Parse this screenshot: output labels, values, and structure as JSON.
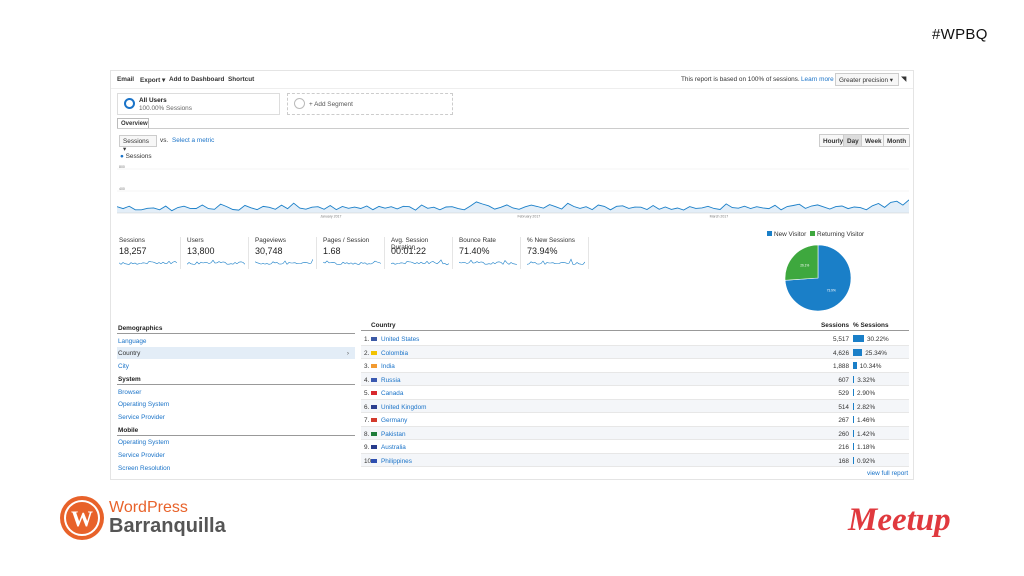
{
  "slide": {
    "hashtag": "#WPBQ"
  },
  "toolbar": {
    "items": [
      "Email",
      "Export ▾",
      "Add to Dashboard",
      "Shortcut"
    ],
    "report_note": "This report is based on 100% of sessions.",
    "learn_more": "Learn more",
    "precision": "Greater precision ▾"
  },
  "segments": {
    "all_users_title": "All Users",
    "all_users_sub": "100.00% Sessions",
    "add_segment": "+ Add Segment"
  },
  "tabs": {
    "overview": "Overview"
  },
  "chart_controls": {
    "metric": "Sessions ▾",
    "vs": "vs.",
    "select_metric": "Select a metric",
    "granularity": [
      "Hourly",
      "Day",
      "Week",
      "Month"
    ],
    "active_granularity": "Day",
    "legend": "Sessions"
  },
  "chart_data": {
    "type": "line",
    "series": [
      {
        "name": "Sessions",
        "values": [
          295,
          275,
          300,
          262,
          262,
          278,
          282,
          263,
          301,
          253,
          286,
          300,
          277,
          276,
          313,
          275,
          268,
          322,
          296,
          266,
          259,
          308,
          283,
          265,
          298,
          289,
          268,
          311,
          274,
          331,
          280,
          269,
          290,
          295,
          268,
          307,
          265,
          297,
          278,
          291,
          276,
          302,
          264,
          298,
          279,
          295,
          272,
          299,
          295,
          259,
          313,
          278,
          290,
          262,
          292,
          295,
          275,
          263,
          302,
          345,
          323,
          304,
          270,
          289,
          314,
          281,
          268,
          294,
          311,
          297,
          279,
          317,
          295,
          271,
          330,
          297,
          277,
          295,
          265,
          312,
          298,
          263,
          299,
          304,
          277,
          291,
          290,
          266,
          307,
          268,
          292,
          267,
          281,
          260,
          296,
          277,
          282,
          299,
          276,
          266,
          324,
          285,
          279,
          300,
          276,
          295,
          282,
          275,
          309,
          263,
          297,
          307,
          321,
          277,
          302,
          314,
          293,
          271,
          296,
          302,
          275,
          292,
          285,
          263,
          304,
          328,
          287,
          340,
          352,
          311,
          366
        ]
      }
    ],
    "x_tick_labels": [
      "January 2017",
      "February 2017",
      "March 2017"
    ],
    "y_tick_labels": [
      "800",
      "400"
    ],
    "ylim": [
      0,
      800
    ],
    "color": "#1a7fc8"
  },
  "scorecards": [
    {
      "label": "Sessions",
      "value": "18,257"
    },
    {
      "label": "Users",
      "value": "13,800"
    },
    {
      "label": "Pageviews",
      "value": "30,748"
    },
    {
      "label": "Pages / Session",
      "value": "1.68"
    },
    {
      "label": "Avg. Session Duration",
      "value": "00:01:22"
    },
    {
      "label": "Bounce Rate",
      "value": "71.40%"
    },
    {
      "label": "% New Sessions",
      "value": "73.94%"
    }
  ],
  "pie": {
    "legend": [
      {
        "label": "New Visitor",
        "color": "#1a7fc8",
        "value": 73.9
      },
      {
        "label": "Returning Visitor",
        "color": "#3ea83e",
        "value": 26.1
      }
    ]
  },
  "left_table": {
    "rows": [
      {
        "text": "Demographics",
        "kind": "head"
      },
      {
        "text": "Language",
        "kind": "link"
      },
      {
        "text": "Country",
        "kind": "active"
      },
      {
        "text": "City",
        "kind": "link"
      },
      {
        "text": "System",
        "kind": "head"
      },
      {
        "text": "Browser",
        "kind": "link"
      },
      {
        "text": "Operating System",
        "kind": "link"
      },
      {
        "text": "Service Provider",
        "kind": "link"
      },
      {
        "text": "Mobile",
        "kind": "head"
      },
      {
        "text": "Operating System",
        "kind": "link"
      },
      {
        "text": "Service Provider",
        "kind": "link"
      },
      {
        "text": "Screen Resolution",
        "kind": "link"
      }
    ],
    "chevron": "›"
  },
  "country_table": {
    "headers": {
      "country": "Country",
      "sessions": "Sessions",
      "pct": "% Sessions"
    },
    "rows": [
      {
        "idx": "1.",
        "country": "United States",
        "sessions": "5,517",
        "pct": "30.22%",
        "share": 30.22,
        "flag": "#3c5aa6"
      },
      {
        "idx": "2.",
        "country": "Colombia",
        "sessions": "4,626",
        "pct": "25.34%",
        "share": 25.34,
        "flag": "#f2c200"
      },
      {
        "idx": "3.",
        "country": "India",
        "sessions": "1,888",
        "pct": "10.34%",
        "share": 10.34,
        "flag": "#f29a30"
      },
      {
        "idx": "4.",
        "country": "Russia",
        "sessions": "607",
        "pct": "3.32%",
        "share": 3.32,
        "flag": "#3a59b0"
      },
      {
        "idx": "5.",
        "country": "Canada",
        "sessions": "529",
        "pct": "2.90%",
        "share": 2.9,
        "flag": "#d8282e"
      },
      {
        "idx": "6.",
        "country": "United Kingdom",
        "sessions": "514",
        "pct": "2.82%",
        "share": 2.82,
        "flag": "#2c3f8f"
      },
      {
        "idx": "7.",
        "country": "Germany",
        "sessions": "267",
        "pct": "1.46%",
        "share": 1.46,
        "flag": "#d33a2c"
      },
      {
        "idx": "8.",
        "country": "Pakistan",
        "sessions": "260",
        "pct": "1.42%",
        "share": 1.42,
        "flag": "#1f7d3a"
      },
      {
        "idx": "9.",
        "country": "Australia",
        "sessions": "216",
        "pct": "1.18%",
        "share": 1.18,
        "flag": "#283c8c"
      },
      {
        "idx": "10.",
        "country": "Philippines",
        "sessions": "168",
        "pct": "0.92%",
        "share": 0.92,
        "flag": "#2e4fb0"
      }
    ],
    "view_full": "view full report"
  },
  "logos": {
    "wp_line1": "WordPress",
    "wp_line2": "Barranquilla",
    "meetup": "Meetup",
    "wp_color": "#e8622a",
    "meetup_color": "#e0393e"
  }
}
